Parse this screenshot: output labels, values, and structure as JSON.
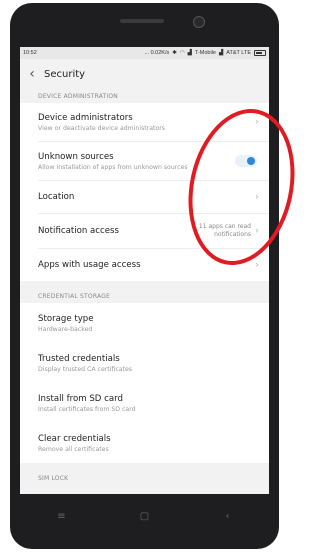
{
  "status": {
    "time": "10:52",
    "speed": "... 0.02K/s",
    "carrier1": "T-Mobile",
    "carrier2": "AT&T LTE"
  },
  "header": {
    "title": "Security"
  },
  "sections": {
    "device_admin": "DEVICE ADMINISTRATION",
    "credential_storage": "CREDENTIAL STORAGE",
    "sim_lock": "SIM LOCK"
  },
  "items": {
    "device_administrators": {
      "title": "Device administrators",
      "subtitle": "View or deactivate device administrators"
    },
    "unknown_sources": {
      "title": "Unknown sources",
      "subtitle": "Allow installation of apps from unknown sources"
    },
    "location": {
      "title": "Location"
    },
    "notification_access": {
      "title": "Notification access",
      "extra": "11 apps can read notifications"
    },
    "apps_usage": {
      "title": "Apps with usage access"
    },
    "storage_type": {
      "title": "Storage type",
      "subtitle": "Hardware-backed"
    },
    "trusted_credentials": {
      "title": "Trusted credentials",
      "subtitle": "Display trusted CA certificates"
    },
    "install_sd": {
      "title": "Install from SD card",
      "subtitle": "Install certificates from SD card"
    },
    "clear_credentials": {
      "title": "Clear credentials",
      "subtitle": "Remove all certificates"
    }
  },
  "toggles": {
    "unknown_sources_enabled": true
  },
  "colors": {
    "accent": "#2b86e4",
    "annotation": "#e11b22"
  },
  "navbar": {
    "menu_icon": "menu-icon",
    "home_icon": "home-icon",
    "back_icon": "back-icon"
  }
}
